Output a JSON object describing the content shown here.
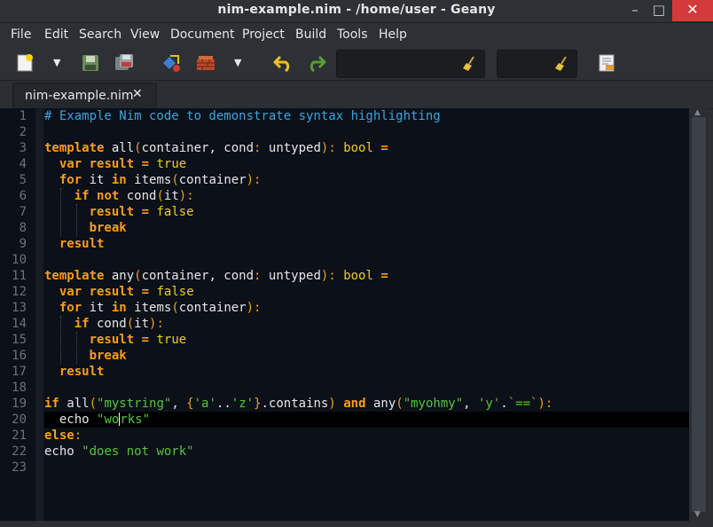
{
  "window": {
    "title": "nim-example.nim - /home/user - Geany",
    "minimize": "–",
    "maximize": "□",
    "close": "✕"
  },
  "menu": [
    "File",
    "Edit",
    "Search",
    "View",
    "Document",
    "Project",
    "Build",
    "Tools",
    "Help"
  ],
  "toolbar": {
    "search_value": "",
    "goto_value": "",
    "icons": [
      "new-file-icon",
      "save-icon",
      "save-all-icon",
      "compile-icon",
      "build-icon",
      "undo-icon",
      "redo-icon",
      "clear-icon",
      "jump-icon"
    ]
  },
  "tabs": [
    {
      "label": "nim-example.nim",
      "close": "✕"
    }
  ],
  "editor": {
    "line_numbers": [
      "1",
      "2",
      "3",
      "4",
      "5",
      "6",
      "7",
      "8",
      "9",
      "10",
      "11",
      "12",
      "13",
      "14",
      "15",
      "16",
      "17",
      "18",
      "19",
      "20",
      "21",
      "22",
      "23"
    ],
    "current_line": 20,
    "colors": {
      "keyword": "#f89e1b",
      "type": "#ebcf19",
      "string": "#55c43c",
      "comment": "#3ba5dd",
      "background": "#0c1019"
    }
  }
}
